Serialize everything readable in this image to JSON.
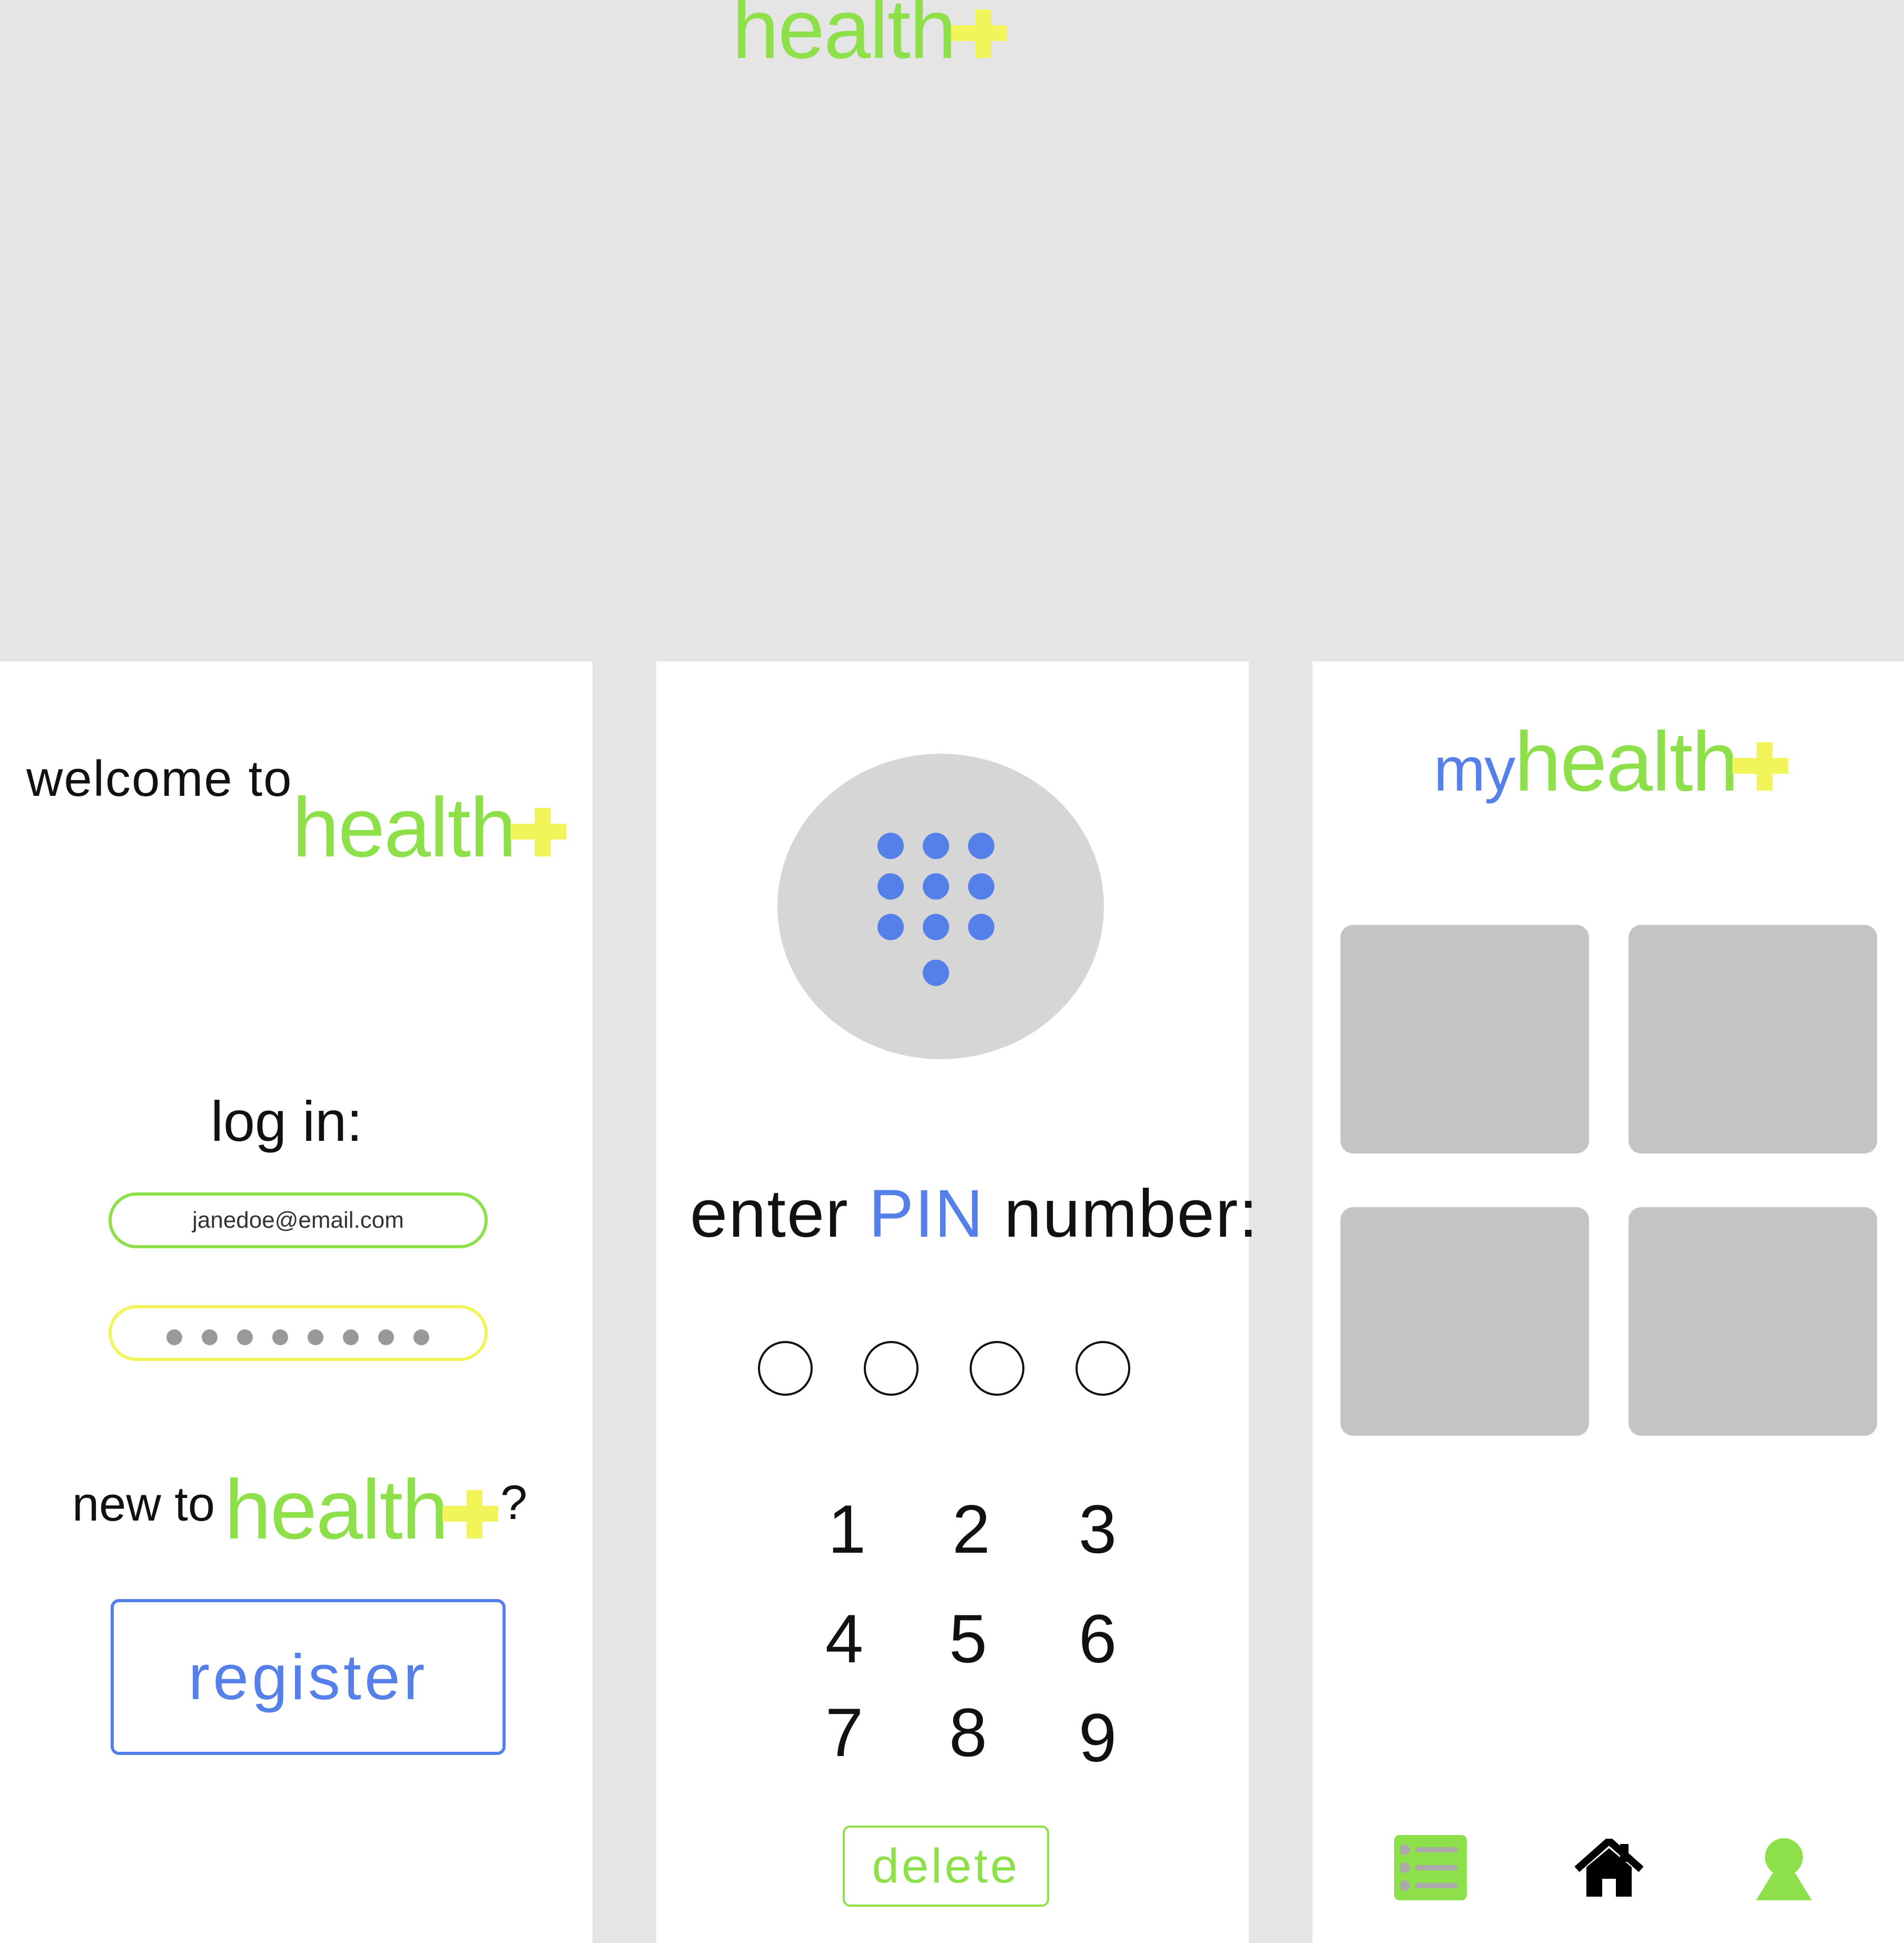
{
  "brand": {
    "word": "health",
    "my_prefix": "my"
  },
  "login": {
    "welcome": "welcome to",
    "heading": "log in:",
    "email_value": "janedoe@email.com",
    "password_dot_count": 8,
    "new_to": "new to",
    "question_mark": "?",
    "register_label": "register"
  },
  "pin": {
    "prompt_start": "enter",
    "prompt_highlight": "PIN",
    "prompt_end": "number:",
    "entered_digits": 0,
    "max_digits": 4,
    "keys": [
      "1",
      "2",
      "3",
      "4",
      "5",
      "6",
      "7",
      "8",
      "9"
    ],
    "delete_label": "delete",
    "icon": "keypad-icon"
  },
  "home": {
    "tile_count": 4,
    "nav": [
      {
        "icon": "list-icon",
        "active": true
      },
      {
        "icon": "home-icon",
        "active": false
      },
      {
        "icon": "profile-icon",
        "active": false
      }
    ]
  },
  "colors": {
    "green": "#8ee04b",
    "yellow": "#f1f55a",
    "blue": "#5580ea",
    "background": "#e5e5e5",
    "tile": "#c4c4c4"
  }
}
